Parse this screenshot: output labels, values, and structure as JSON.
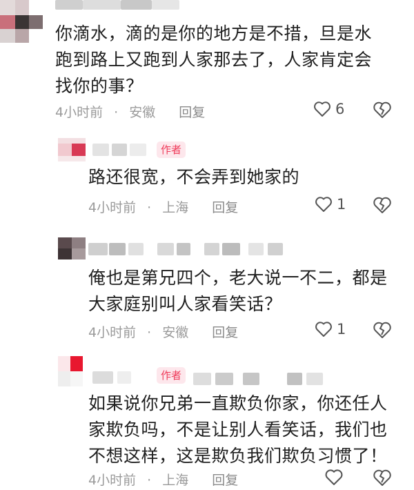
{
  "comments": [
    {
      "text_lines": [
        "你滴水，滴的是你的地方是不措，旦是水",
        "跑到路上又跑到人家那去了，人家肯定会",
        "找你的事？"
      ],
      "time": "4小时前",
      "location": "安徽",
      "reply_label": "回复",
      "likes": "6"
    },
    {
      "badge": "作者",
      "text_lines": [
        "路还很宽，不会弄到她家的"
      ],
      "time": "4小时前",
      "location": "上海",
      "reply_label": "回复",
      "likes": "1"
    },
    {
      "text_lines": [
        "俺也是第兄四个，老大说一不二，都是",
        "大家庭别叫人家看笑话？"
      ],
      "time": "4小时前",
      "location": "安徽",
      "reply_label": "回复",
      "likes": "1"
    },
    {
      "badge": "作者",
      "text_lines": [
        "如果说你兄弟一直欺负你家，你还任人",
        "家欺负吗，不是让别人看笑话，我们也",
        "不想这样，这是欺负我们欺负习惯了！"
      ],
      "time": "4小时前",
      "location": "上海",
      "reply_label": "回复",
      "likes": ""
    }
  ],
  "separator": "·",
  "colors": {
    "badge_bg": "#fde7ec",
    "badge_text": "#ef3b5a",
    "meta": "#9a9a9a"
  }
}
